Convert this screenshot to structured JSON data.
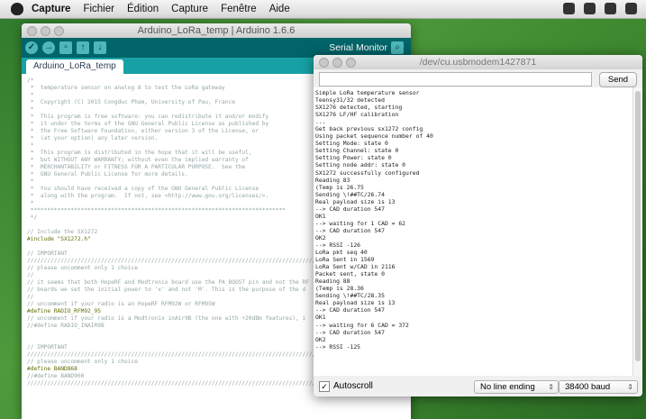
{
  "menubar": {
    "items": [
      "Capture",
      "Fichier",
      "Édition",
      "Capture",
      "Fenêtre",
      "Aide"
    ]
  },
  "ide": {
    "title": "Arduino_LoRa_temp | Arduino 1.6.6",
    "serial_monitor_label": "Serial Monitor",
    "tab": "Arduino_LoRa_temp",
    "code_lines": [
      "/*",
      " *  temperature sensor on analog 8 to test the LoRa gateway",
      " *",
      " *  Copyright (C) 2015 Congduc Pham, University of Pau, France",
      " *",
      " *  This program is free software: you can redistribute it and/or modify",
      " *  it under the terms of the GNU General Public License as published by",
      " *  the Free Software Foundation, either version 3 of the License, or",
      " *  (at your option) any later version.",
      " *",
      " *  This program is distributed in the hope that it will be useful,",
      " *  but WITHOUT ANY WARRANTY; without even the implied warranty of",
      " *  MERCHANTABILITY or FITNESS FOR A PARTICULAR PURPOSE.  See the",
      " *  GNU General Public License for more details.",
      " *",
      " *  You should have received a copy of the GNU General Public License",
      " *  along with the program.  If not, see <http://www.gnu.org/licenses/>.",
      " *",
      " ****************************************************************************",
      " */",
      "",
      "// Include the SX1272",
      "#include \"SX1272.h\"",
      "",
      "// IMPORTANT",
      "///////////////////////////////////////////////////////////////////////////////////////",
      "// please uncomment only 1 choice",
      "//",
      "// it seems that both HopeRF and Modtronix board use the PA_BOOST pin and not the RF",
      "// boards we set the initial power to 'x' and not 'M'. This is the purpose of the d",
      "//",
      "// uncomment if your radio is an HopeRF RFM92W or RFM95W",
      "#define RADIO_RFM92_95",
      "// uncomment if your radio is a Modtronix inAir9B (the one with +20dBm features), i",
      "//#define RADIO_INAIR9B",
      "",
      "",
      "// IMPORTANT",
      "///////////////////////////////////////////////////////////////////////////////////////",
      "// please uncomment only 1 choice",
      "#define BAND868",
      "//#define BAND900",
      "///////////////////////////////////////////////////////////////////////////////////////"
    ]
  },
  "serial": {
    "title": "/dev/cu.usbmodem1427871",
    "input_value": "",
    "send_label": "Send",
    "output_lines": [
      "Simple LoRa temperature sensor",
      "Teensy31/32 detected",
      "SX1276 detected, starting",
      "SX1276 LF/HF calibration",
      "...",
      "Get back previous sx1272 config",
      "Using packet sequence number of 40",
      "Setting Mode: state 0",
      "Setting Channel: state 0",
      "Setting Power: state 0",
      "Setting node addr: state 0",
      "SX1272 successfully configured",
      "Reading 83",
      "(Temp is 26.75",
      "Sending \\!##TC/26.74",
      "Real payload size is 13",
      "--> CAD duration 547",
      "OK1",
      "--> waiting for 1 CAD = 62",
      "--> CAD duration 547",
      "OK2",
      "--> RSSI -126",
      "LoRa pkt seq 40",
      "LoRa Sent in 1569",
      "LoRa Sent w/CAD in 2116",
      "Packet sent, state 0",
      "Reading 88",
      "(Temp is 28.36",
      "Sending \\!##TC/28.35",
      "Real payload size is 13",
      "--> CAD duration 547",
      "OK1",
      "--> waiting for 6 CAD = 372",
      "--> CAD duration 547",
      "OK2",
      "--> RSSI -125"
    ],
    "autoscroll_label": "Autoscroll",
    "autoscroll_checked": "✓",
    "line_ending": "No line ending",
    "baud": "38400 baud"
  }
}
